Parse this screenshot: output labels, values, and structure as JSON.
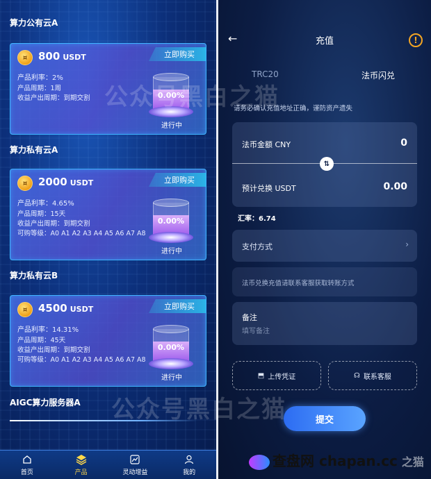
{
  "left": {
    "sections": [
      {
        "title": "算力公有云A",
        "amount": "800",
        "unit": "USDT",
        "buy": "立即购买",
        "lines": [
          "产品利率：2%",
          "产品周期：1周",
          "收益产出周期：到期交割"
        ],
        "percent": "0.00%",
        "status": "进行中"
      },
      {
        "title": "算力私有云A",
        "amount": "2000",
        "unit": "USDT",
        "buy": "立即购买",
        "lines": [
          "产品利率：4.65%",
          "产品周期：15天",
          "收益产出周期：到期交割",
          "可购等级：A0 A1 A2 A3 A4 A5 A6 A7 A8"
        ],
        "percent": "0.00%",
        "status": "进行中"
      },
      {
        "title": "算力私有云B",
        "amount": "4500",
        "unit": "USDT",
        "buy": "立即购买",
        "lines": [
          "产品利率：14.31%",
          "产品周期：45天",
          "收益产出周期：到期交割",
          "可购等级：A0 A1 A2 A3 A4 A5 A6 A7 A8"
        ],
        "percent": "0.00%",
        "status": "进行中"
      }
    ],
    "aigc_title": "AIGC算力服务器A",
    "tabbar": [
      {
        "label": "首页",
        "icon": "home-icon"
      },
      {
        "label": "产品",
        "icon": "layers-icon"
      },
      {
        "label": "灵动增益",
        "icon": "chart-icon"
      },
      {
        "label": "我的",
        "icon": "user-icon"
      }
    ],
    "active_tab": 1
  },
  "right": {
    "title": "充值",
    "tabs": [
      "TRC20",
      "法币闪兑"
    ],
    "tip": "请务必确认充值地址正确，谨防资产遗失",
    "fiat_label": "法币金额 CNY",
    "fiat_value": "0",
    "usdt_label": "预计兑换 USDT",
    "usdt_value": "0.00",
    "rate": "汇率：6.74",
    "pay_label": "支付方式",
    "info": "法币兑换充值请联系客服获取转账方式",
    "note_label": "备注",
    "note_placeholder": "填写备注",
    "upload": "上传凭证",
    "contact": "联系客服",
    "submit": "提交"
  },
  "watermark": {
    "text": "公众号黑白之猫",
    "site": "查盘网 chapan.cc",
    "cat": "之猫"
  },
  "colors": {
    "accent": "#ffd84a",
    "warn": "#f5a623",
    "card_border": "#3fb4ff",
    "submit": "#3a86ff"
  }
}
